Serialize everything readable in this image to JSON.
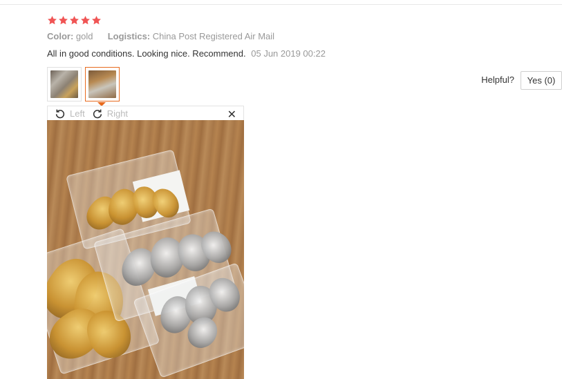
{
  "review": {
    "rating": 5,
    "star_color": "#f05555",
    "attributes": [
      {
        "key": "Color:",
        "value": "gold"
      },
      {
        "key": "Logistics:",
        "value": "China Post Registered Air Mail"
      }
    ],
    "text": "All in good conditions. Looking nice. Recommend.",
    "date": "05 Jun 2019 00:22"
  },
  "helpful": {
    "label": "Helpful?",
    "yes_label": "Yes (0)"
  },
  "viewer": {
    "rotate_left_label": "Left",
    "rotate_right_label": "Right",
    "close_glyph": "✕",
    "accent_color": "#e86a1d"
  },
  "icons": {
    "rotate_left": "rotate-left-icon",
    "rotate_right": "rotate-right-icon",
    "close": "close-icon",
    "star": "star-icon"
  }
}
